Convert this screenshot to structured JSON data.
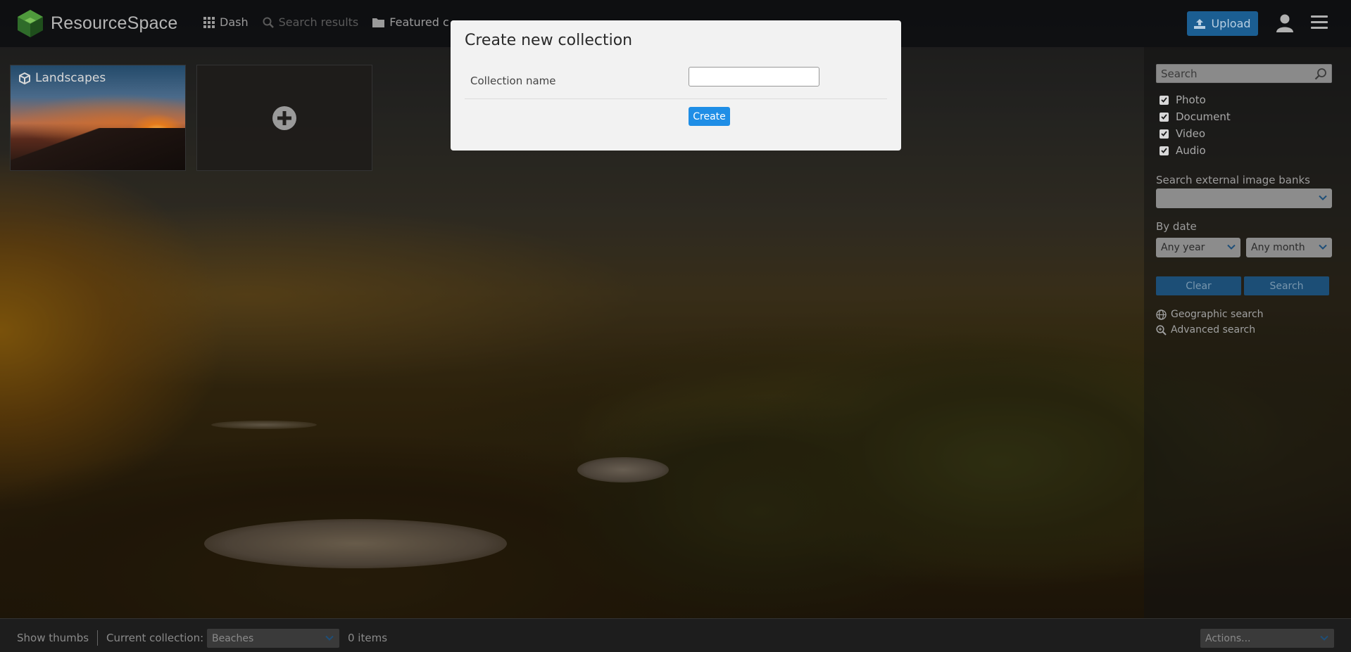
{
  "header": {
    "brand": "ResourceSpace",
    "nav": [
      {
        "label": "Dash",
        "icon": "grid-icon"
      },
      {
        "label": "Search results",
        "icon": "search-icon"
      },
      {
        "label": "Featured c",
        "icon": "folder-icon"
      }
    ],
    "upload_label": "Upload",
    "accent": "#1b5e92"
  },
  "collections": [
    {
      "title": "Landscapes",
      "icon": "cube-icon"
    }
  ],
  "sidebar": {
    "search_placeholder": "Search",
    "types": [
      {
        "label": "Photo",
        "checked": true
      },
      {
        "label": "Document",
        "checked": true
      },
      {
        "label": "Video",
        "checked": true
      },
      {
        "label": "Audio",
        "checked": true
      }
    ],
    "external_label": "Search external image banks",
    "external_value": "",
    "date_label": "By date",
    "year_value": "Any year",
    "month_value": "Any month",
    "clear_label": "Clear",
    "search_label": "Search",
    "geo_label": "Geographic search",
    "advanced_label": "Advanced search"
  },
  "modal": {
    "title": "Create new collection",
    "field_label": "Collection name",
    "field_value": "",
    "create_label": "Create",
    "button_color": "#1f8ee6"
  },
  "footer": {
    "show_thumbs": "Show thumbs",
    "current_label": "Current collection:",
    "current_value": "Beaches",
    "items": "0 items",
    "actions_value": "Actions..."
  }
}
